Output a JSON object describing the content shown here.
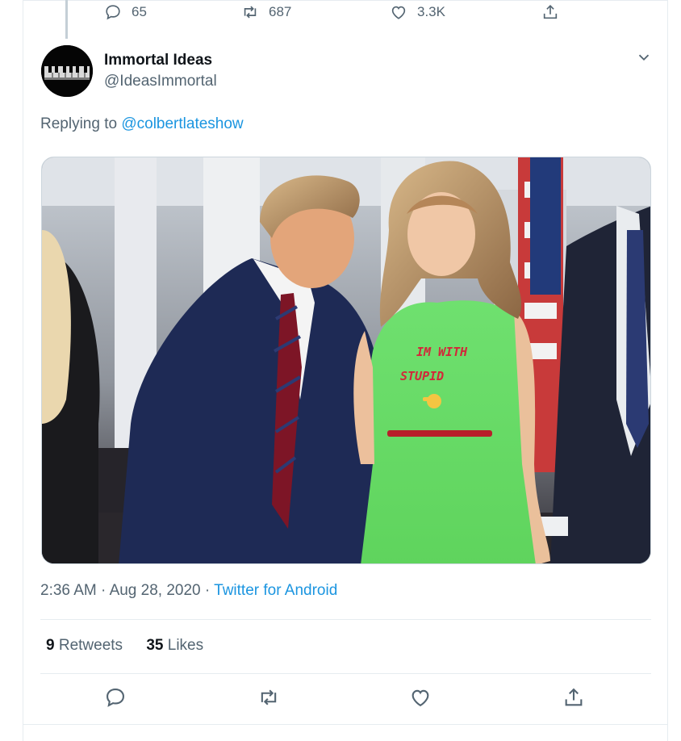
{
  "previous_tweet": {
    "reply_count": "65",
    "retweet_count": "687",
    "like_count": "3.3K",
    "icons": [
      "reply-icon",
      "retweet-icon",
      "like-icon",
      "share-icon"
    ]
  },
  "tweet": {
    "author_name": "Immortal Ideas",
    "author_handle": "@IdeasImmortal",
    "replying_prefix": "Replying to",
    "replying_to": "@colbertlateshow",
    "image_text_line1": "IM WITH",
    "image_text_line2": "STUPID",
    "time": "2:36 AM",
    "separator": "·",
    "date": "Aug 28, 2020",
    "source": "Twitter for Android",
    "retweets_count": "9",
    "retweets_label": "Retweets",
    "likes_count": "35",
    "likes_label": "Likes",
    "actions": [
      "reply-icon",
      "retweet-icon",
      "like-icon",
      "share-icon"
    ]
  },
  "colors": {
    "accent": "#1b95e0",
    "secondary_text": "#536471",
    "border": "#e6ecf0"
  }
}
